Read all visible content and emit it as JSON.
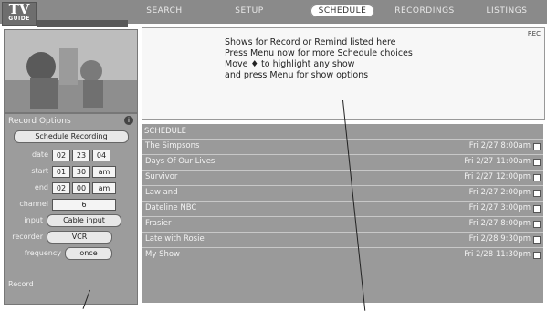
{
  "logo": {
    "line1": "TV",
    "line2": "GUIDE"
  },
  "tabs": [
    {
      "label": "SEARCH",
      "active": false
    },
    {
      "label": "SETUP",
      "active": false
    },
    {
      "label": "SCHEDULE",
      "active": true
    },
    {
      "label": "RECORDINGS",
      "active": false
    },
    {
      "label": "LISTINGS",
      "active": false
    }
  ],
  "channel_badge": "",
  "video_alt": "live TV preview",
  "left_panel": {
    "title": "Record Options",
    "schedule_button": "Schedule Recording",
    "fields": [
      {
        "label": "date",
        "values": [
          "02",
          "23",
          "04"
        ]
      },
      {
        "label": "start",
        "values": [
          "01",
          "30",
          "am"
        ]
      },
      {
        "label": "end",
        "values": [
          "02",
          "00",
          "am"
        ]
      },
      {
        "label": "channel",
        "values": [
          "6"
        ]
      },
      {
        "label": "input",
        "values": [
          "Cable input"
        ]
      },
      {
        "label": "recorder",
        "values": [
          "VCR"
        ]
      },
      {
        "label": "frequency",
        "values": [
          "once"
        ]
      }
    ],
    "footer": "Record"
  },
  "info": {
    "lines": [
      "Shows for Record or Remind listed here",
      "Press Menu now for more Schedule choices",
      "Move ♦ to highlight any show",
      "and press Menu for show options"
    ],
    "badge": "REC"
  },
  "schedule": {
    "header": "SCHEDULE",
    "rows": [
      {
        "title": "The Simpsons",
        "date": "Fri 2/27  8:00am"
      },
      {
        "title": "Days Of Our Lives",
        "date": "Fri 2/27 11:00am"
      },
      {
        "title": "Survivor",
        "date": "Fri 2/27 12:00pm"
      },
      {
        "title": "Law and",
        "date": "Fri 2/27  2:00pm"
      },
      {
        "title": "Dateline NBC",
        "date": "Fri 2/27  3:00pm"
      },
      {
        "title": "Frasier",
        "date": "Fri 2/27  8:00pm"
      },
      {
        "title": "Late with Rosie",
        "date": "Fri 2/28  9:30pm"
      },
      {
        "title": "My Show",
        "date": "Fri 2/28 11:30pm"
      }
    ]
  }
}
